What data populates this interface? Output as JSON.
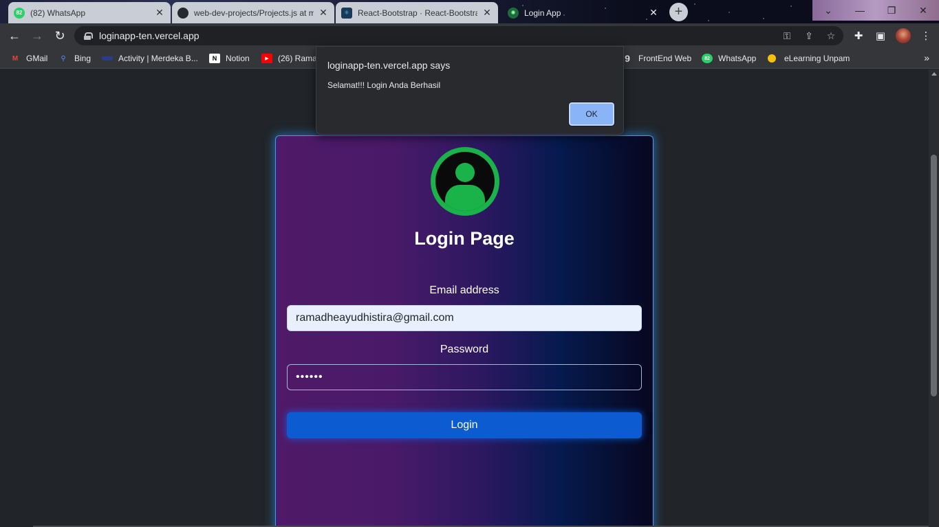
{
  "browser": {
    "tabs": [
      {
        "label": "(82) WhatsApp",
        "badge": "82",
        "state": "inactive",
        "icon": "whatsapp-icon"
      },
      {
        "label": "web-dev-projects/Projects.js at m",
        "state": "inactive",
        "icon": "github-icon"
      },
      {
        "label": "React-Bootstrap · React-Bootstra",
        "state": "inactive",
        "icon": "react-bootstrap-icon"
      },
      {
        "label": "Login App",
        "state": "active",
        "icon": "globe-icon"
      }
    ],
    "close_glyph": "✕",
    "new_tab_glyph": "+",
    "window_controls": {
      "search": "⌄",
      "minimize": "—",
      "restore": "❐",
      "close": "✕"
    },
    "url": "loginapp-ten.vercel.app",
    "bookmarks": [
      {
        "label": "GMail",
        "icon": "gmail-icon"
      },
      {
        "label": "Bing",
        "icon": "bing-search-icon"
      },
      {
        "label": "Activity | Merdeka B...",
        "icon": "merdeka-icon"
      },
      {
        "label": "Notion",
        "icon": "notion-icon"
      },
      {
        "label": "(26) Rama",
        "icon": "youtube-icon"
      },
      {
        "label": "FrontEnd Web",
        "icon": "frontend-icon"
      },
      {
        "label": "WhatsApp",
        "badge": "82",
        "icon": "whatsapp-icon"
      },
      {
        "label": "eLearning Unpam",
        "icon": "elearning-icon"
      }
    ],
    "bookmarks_more": "»"
  },
  "dialog": {
    "title": "loginapp-ten.vercel.app says",
    "message": "Selamat!!! Login Anda Berhasil",
    "ok_label": "OK"
  },
  "login": {
    "title": "Login Page",
    "email_label": "Email address",
    "email_value": "ramadheayudhistira@gmail.com",
    "password_label": "Password",
    "password_value": "••••••",
    "button_label": "Login"
  },
  "colors": {
    "accent": "#0d5bd1",
    "card_border": "#2aa3ff",
    "avatar_green": "#19b34a"
  }
}
